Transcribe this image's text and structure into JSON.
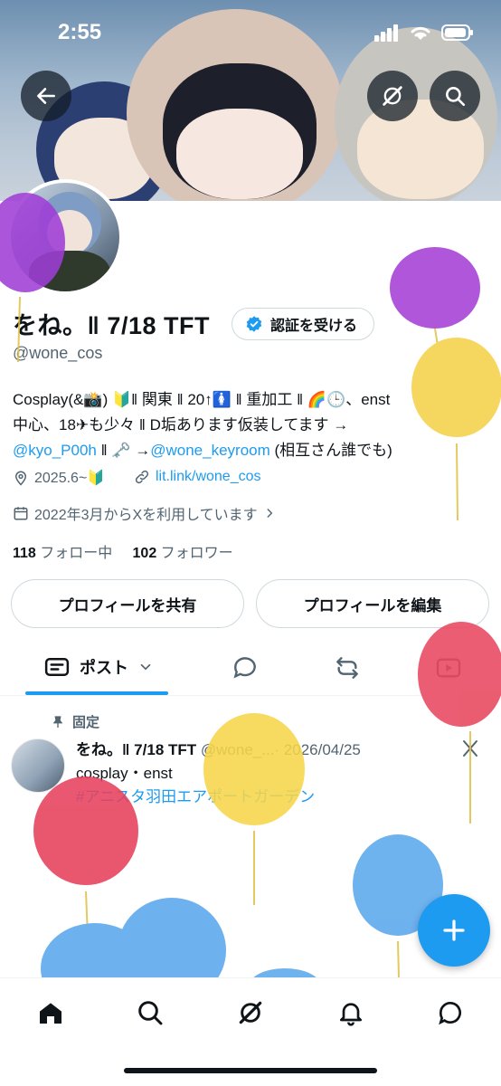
{
  "status": {
    "time": "2:55"
  },
  "profile": {
    "name": "をね。‖ 7/18 TFT",
    "verify_label": "認証を受ける",
    "handle": "@wone_cos",
    "bio": {
      "line1": "Cosplay(&📸) 🔰‖ 関東 ‖ 20↑🚺 ‖ 重加工 ‖ 🌈🕒、enst",
      "line2": "中心、18✈︎も少々 ‖ D垢あります仮装してます →",
      "link1": "@kyo_P00h",
      "mid": " ‖ 🗝️ →",
      "link2": "@wone_keyroom",
      "tail": " (相互さん誰でも)"
    },
    "location": "2025.6~🔰",
    "website": "lit.link/wone_cos",
    "joined": "2022年3月からXを利用しています",
    "following_count": "118",
    "following_label": "フォロー中",
    "followers_count": "102",
    "followers_label": "フォロワー"
  },
  "buttons": {
    "share": "プロフィールを共有",
    "edit": "プロフィールを編集"
  },
  "tabs": {
    "posts": "ポスト"
  },
  "pinned_tweet": {
    "pinned_label": "固定",
    "author": "をね。‖ 7/18 TFT",
    "handle": "@wone_...",
    "date": "· 2026/04/25",
    "text": "cosplay・enst",
    "hashtag": "#アニスタ羽田エアポートガーデン"
  },
  "colors": {
    "accent": "#1d9bf0",
    "text": "#0f1419",
    "muted": "#536471"
  }
}
